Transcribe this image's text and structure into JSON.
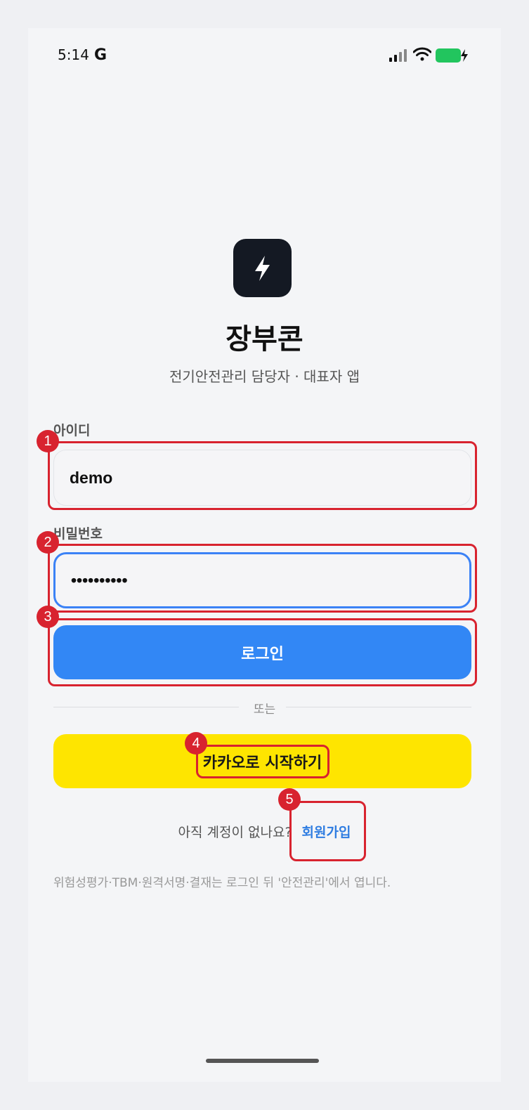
{
  "status_bar": {
    "time": "5:14",
    "notification_icon": "G",
    "icons": [
      "signal-icon",
      "wifi-icon",
      "battery-charging-icon"
    ]
  },
  "app": {
    "name": "장부콘",
    "subtitle": "전기안전관리 담당자 · 대표자 앱",
    "logo_icon": "lightning-bolt-icon"
  },
  "login_form": {
    "id_label": "아이디",
    "id_value": "demo",
    "password_label": "비밀번호",
    "password_value": "••••••••••",
    "login_button": "로그인",
    "divider_text": "또는",
    "kakao_button": "카카오로 시작하기"
  },
  "signup": {
    "prompt": "아직 계정이 없나요?",
    "link": "회원가입"
  },
  "footnote": "위험성평가·TBM·원격서명·결재는 로그인 뒤 '안전관리'에서 엽니다.",
  "annotations": [
    "1",
    "2",
    "3",
    "4",
    "5"
  ],
  "colors": {
    "primary": "#3287f5",
    "kakao": "#fee500",
    "annotation": "#d8232f",
    "logo_bg": "#141923"
  }
}
